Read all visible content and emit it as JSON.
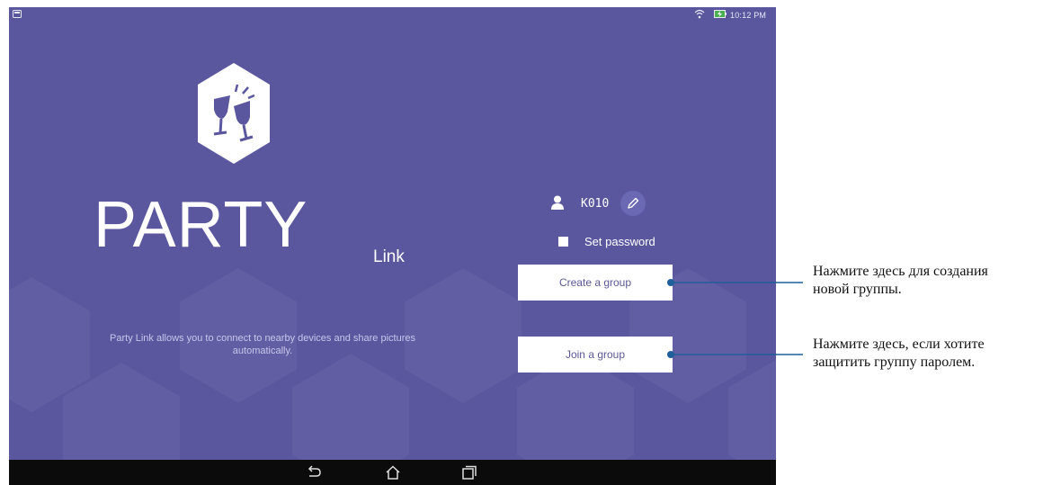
{
  "status_bar": {
    "time": "10:12 PM",
    "icons": [
      "notification-icon",
      "wifi-icon",
      "battery-charging-icon"
    ]
  },
  "app": {
    "logo_icon": "party-glasses-icon",
    "title": "PARTY",
    "subtitle": "Link",
    "description": "Party Link allows you to connect to nearby devices and share pictures automatically."
  },
  "user": {
    "icon": "person-icon",
    "device_name": "K010",
    "edit_icon": "pencil-icon"
  },
  "password": {
    "label": "Set password",
    "checked": false
  },
  "buttons": {
    "create": "Create a group",
    "join": "Join a group"
  },
  "navbar": {
    "icons": [
      "back-icon",
      "home-icon",
      "recent-apps-icon"
    ]
  },
  "annotations": {
    "create": "Нажмите здесь для создания новой группы.",
    "create_line1": "Нажмите здесь для создания",
    "create_line2": "новой группы.",
    "join": "Нажмите здесь, если хотите защитить группу паролем.",
    "join_line1": "Нажмите здесь, если хотите",
    "join_line2": "защитить группу паролем."
  },
  "colors": {
    "background": "#5a579f",
    "button_text": "#5b5896",
    "callout_line": "#1f5f9a",
    "navbar": "#0b0b0b"
  }
}
